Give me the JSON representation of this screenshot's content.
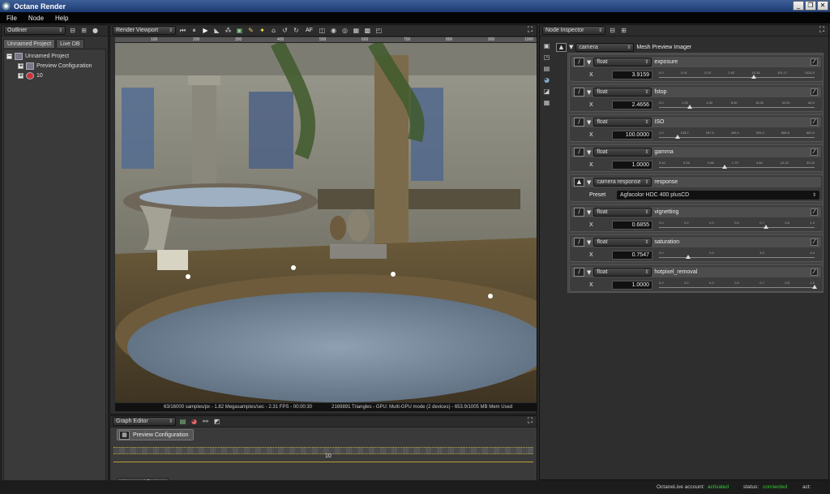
{
  "app": {
    "title": "Octane Render"
  },
  "menu": [
    "File",
    "Node",
    "Help"
  ],
  "window_controls": {
    "minimize": "_",
    "restore": "❐",
    "close": "✕"
  },
  "outliner": {
    "combo": "Outliner",
    "tabs": [
      "Unnamed Project",
      "Live DB"
    ],
    "tree": [
      {
        "label": "Unnamed Project",
        "expander": "−"
      },
      {
        "label": "Preview Configuration",
        "expander": "+"
      },
      {
        "label": "10",
        "expander": "+"
      }
    ]
  },
  "viewport": {
    "combo": "Render Viewport",
    "af_label": "AF",
    "ruler_ticks": [
      "100",
      "200",
      "300",
      "400",
      "500",
      "600",
      "700",
      "800",
      "900",
      "1000"
    ],
    "status_left": "63/16000 samples/px - 1.82 Megasamples/sec - 2.31 FPS - 00:00:30",
    "status_right": "2169891 Triangles - GPU: Multi-GPU mode (2 devices) - 653.9/1005 MB Mem Used"
  },
  "graph_editor": {
    "combo": "Graph Editor",
    "node_label": "Preview Configuration",
    "pin_label": "10",
    "tab": "Unnamed Project"
  },
  "node_inspector": {
    "combo": "Node Inspector",
    "root_type": "camera",
    "root_name": "Mesh Preview Imager",
    "params": [
      {
        "type": "float",
        "name": "exposure",
        "axis": "X",
        "value": "3.9159",
        "ticks": [
          "0.0",
          "0.01",
          "0.15",
          "1.62",
          "10.16",
          "101.17",
          "1024.0"
        ],
        "pos": 0.61
      },
      {
        "type": "float",
        "name": "fstop",
        "axis": "X",
        "value": "2.4656",
        "ticks": [
          "0.0",
          "1.00",
          "4.00",
          "8.00",
          "16.00",
          "32.00",
          "64.0"
        ],
        "pos": 0.2
      },
      {
        "type": "float",
        "name": "ISO",
        "axis": "X",
        "value": "100.0000",
        "ticks": [
          "1.0",
          "133.2",
          "267.5",
          "400.0",
          "533.2",
          "666.8",
          "800.0"
        ],
        "pos": 0.12
      },
      {
        "type": "float",
        "name": "gamma",
        "axis": "X",
        "value": "1.0000",
        "ticks": [
          "0.10",
          "0.26",
          "0.68",
          "1.79",
          "4.66",
          "12.24",
          "32.00"
        ],
        "pos": 0.42
      },
      {
        "type": "camera response",
        "name": "response",
        "axis": "Preset",
        "preset": "Agfacolor HDC 400 plusCD",
        "ticks": []
      },
      {
        "type": "float",
        "name": "vignetting",
        "axis": "X",
        "value": "0.6855",
        "ticks": [
          "0.0",
          "0.2",
          "0.3",
          "0.5",
          "0.7",
          "0.8",
          "1.0"
        ],
        "pos": 0.69
      },
      {
        "type": "float",
        "name": "saturation",
        "axis": "X",
        "value": "0.7547",
        "ticks": [
          "0.0",
          "2.0",
          "3.0",
          "4.0"
        ],
        "pos": 0.19
      },
      {
        "type": "float",
        "name": "hotpixel_removal",
        "axis": "X",
        "value": "1.0000",
        "ticks": [
          "0.0",
          "0.2",
          "0.3",
          "0.5",
          "0.7",
          "0.8",
          "1.0"
        ],
        "pos": 1.0
      }
    ]
  },
  "status": {
    "account_label": "OctaneLive account:",
    "account_value": "activated",
    "status_label": "status:",
    "status_value": "connected",
    "act_label": "act:"
  }
}
